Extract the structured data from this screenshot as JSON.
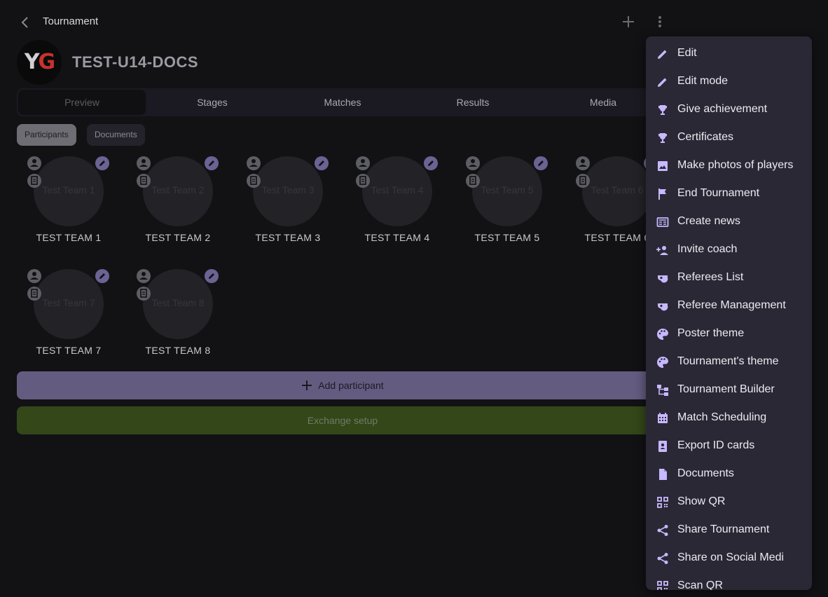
{
  "topbar": {
    "title": "Tournament"
  },
  "tournament": {
    "name": "TEST-U14-DOCS",
    "logo_text_left": "Y",
    "logo_text_right": "G"
  },
  "tabs": [
    "Preview",
    "Stages",
    "Matches",
    "Results",
    "Media"
  ],
  "chips": [
    "Participants",
    "Documents"
  ],
  "teams": [
    {
      "circle_label": "Test Team 1",
      "name": "TEST TEAM 1"
    },
    {
      "circle_label": "Test Team 2",
      "name": "TEST TEAM 2"
    },
    {
      "circle_label": "Test Team 3",
      "name": "TEST TEAM 3"
    },
    {
      "circle_label": "Test Team 4",
      "name": "TEST TEAM 4"
    },
    {
      "circle_label": "Test Team 5",
      "name": "TEST TEAM 5"
    },
    {
      "circle_label": "Test Team 6",
      "name": "TEST TEAM 6"
    },
    {
      "circle_label": "Test Team 7",
      "name": "TEST TEAM 7"
    },
    {
      "circle_label": "Test Team 8",
      "name": "TEST TEAM 8"
    }
  ],
  "buttons": {
    "add_participant": "Add participant",
    "exchange_setup": "Exchange setup"
  },
  "menu": [
    {
      "label": "Edit",
      "icon": "pencil-icon"
    },
    {
      "label": "Edit mode",
      "icon": "pencil-icon"
    },
    {
      "label": "Give achievement",
      "icon": "trophy-icon"
    },
    {
      "label": "Certificates",
      "icon": "trophy-icon"
    },
    {
      "label": "Make photos of players",
      "icon": "image-icon"
    },
    {
      "label": "End Tournament",
      "icon": "flag-icon"
    },
    {
      "label": "Create news",
      "icon": "news-icon"
    },
    {
      "label": "Invite coach",
      "icon": "person-add-icon"
    },
    {
      "label": "Referees List",
      "icon": "whistle-icon"
    },
    {
      "label": "Referee Management",
      "icon": "whistle-icon"
    },
    {
      "label": "Poster theme",
      "icon": "palette-icon"
    },
    {
      "label": "Tournament's theme",
      "icon": "palette-icon"
    },
    {
      "label": "Tournament Builder",
      "icon": "tree-icon"
    },
    {
      "label": "Match Scheduling",
      "icon": "calendar-icon"
    },
    {
      "label": "Export ID cards",
      "icon": "id-card-icon"
    },
    {
      "label": "Documents",
      "icon": "document-icon"
    },
    {
      "label": "Show QR",
      "icon": "qr-icon"
    },
    {
      "label": "Share Tournament",
      "icon": "share-icon"
    },
    {
      "label": "Share on Social Medi",
      "icon": "share-icon"
    },
    {
      "label": "Scan QR",
      "icon": "qr-icon"
    }
  ],
  "colors": {
    "accent": "#c8b8ff",
    "background": "#121215",
    "menu_bg": "#2a2834",
    "add_button": "#645c80",
    "exchange_button": "#334719"
  }
}
